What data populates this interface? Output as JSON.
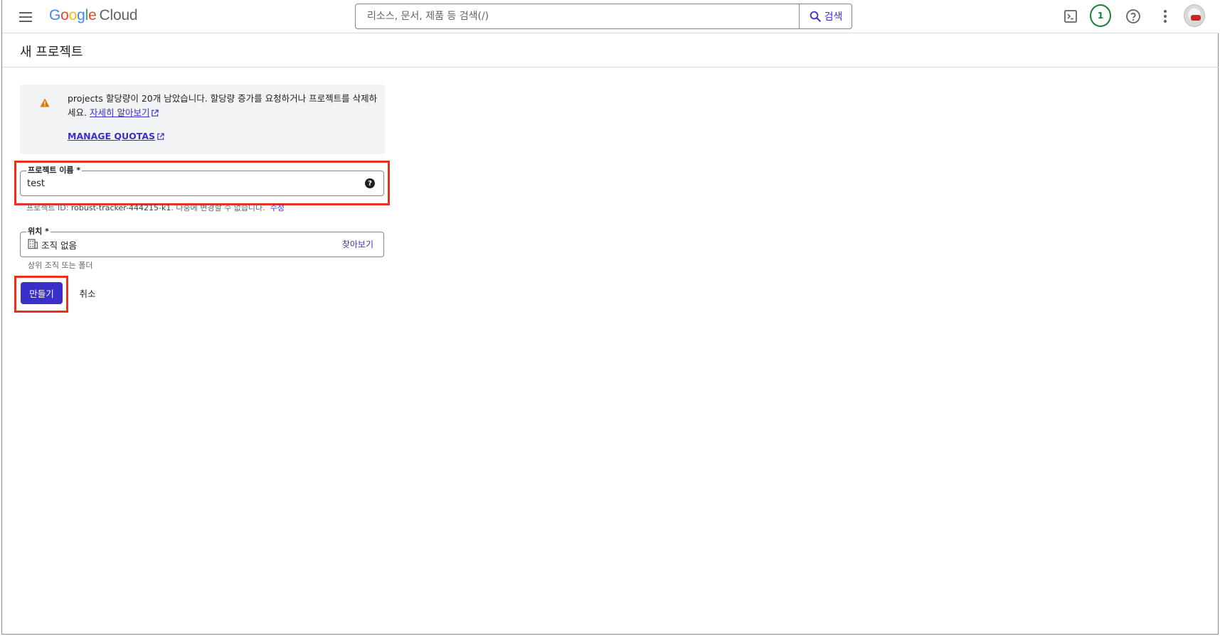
{
  "header": {
    "logo_google": "Google",
    "logo_cloud": "Cloud",
    "search_placeholder": "리소스, 문서, 제품 등 검색(/)",
    "search_button": "검색",
    "notification_count": "1"
  },
  "page": {
    "title": "새 프로젝트"
  },
  "warning": {
    "message": "projects 할당량이 20개 남았습니다. 할당량 증가를 요청하거나 프로젝트를 삭제하세요.",
    "learn_more": "자세히 알아보기",
    "manage_quotas": "MANAGE QUOTAS"
  },
  "project_name": {
    "label": "프로젝트 이름 *",
    "value": "test",
    "id_hint_prefix": "프로젝트 ID:",
    "project_id": "robust-tracker-444215-k1",
    "id_hint_suffix": ". 나중에 변경할 수 없습니다.",
    "edit_link": "수정"
  },
  "location": {
    "label": "위치 *",
    "value": "조직 없음",
    "browse": "찾아보기",
    "hint": "상위 조직 또는 폴더"
  },
  "actions": {
    "create": "만들기",
    "cancel": "취소"
  },
  "colors": {
    "accent": "#3b2fc9",
    "highlight": "#e8321f",
    "warning_icon": "#e37400",
    "notification": "#188038"
  }
}
